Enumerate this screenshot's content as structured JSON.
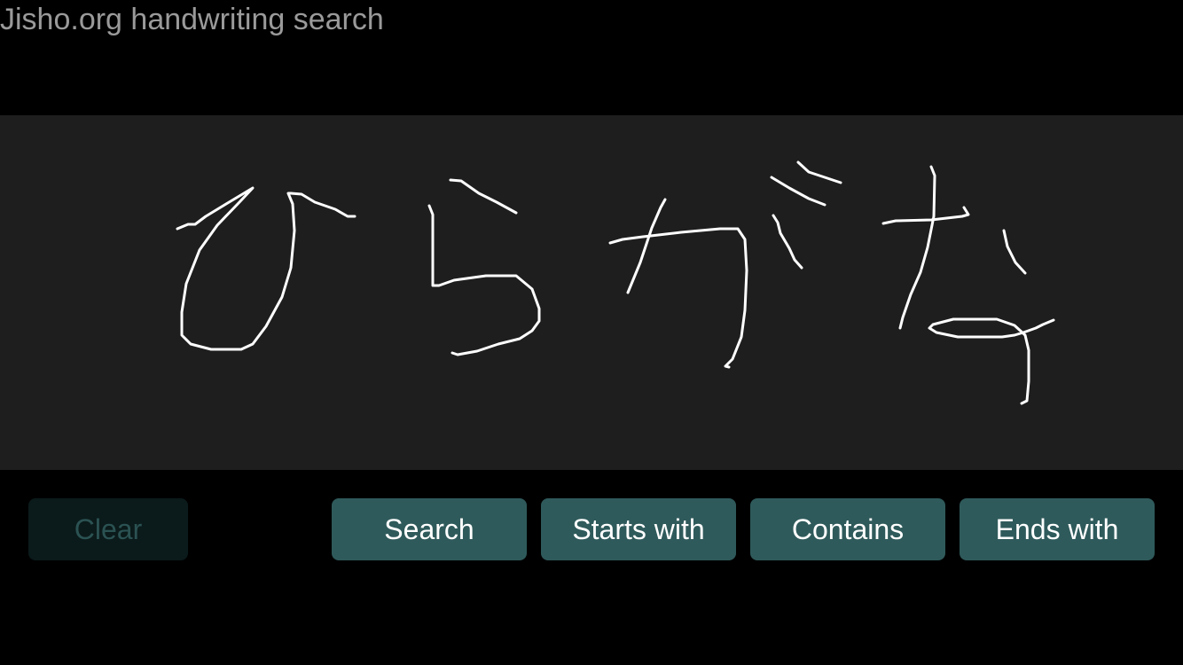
{
  "header": {
    "title": "Jisho.org handwriting search"
  },
  "canvas": {
    "background": "#1e1e1e",
    "stroke_color": "#ffffff",
    "strokes_count": 12
  },
  "buttons": {
    "clear": {
      "label": "Clear",
      "enabled": false
    },
    "search": {
      "label": "Search",
      "enabled": true
    },
    "starts_with": {
      "label": "Starts with",
      "enabled": true
    },
    "contains": {
      "label": "Contains",
      "enabled": true
    },
    "ends_with": {
      "label": "Ends with",
      "enabled": true
    }
  },
  "colors": {
    "page_background": "#000000",
    "title_text": "#9a9a9a",
    "button_background": "#2f5a5b",
    "button_text": "#ffffff",
    "button_disabled_background": "#0b1a1a",
    "button_disabled_text": "#2b5253"
  }
}
